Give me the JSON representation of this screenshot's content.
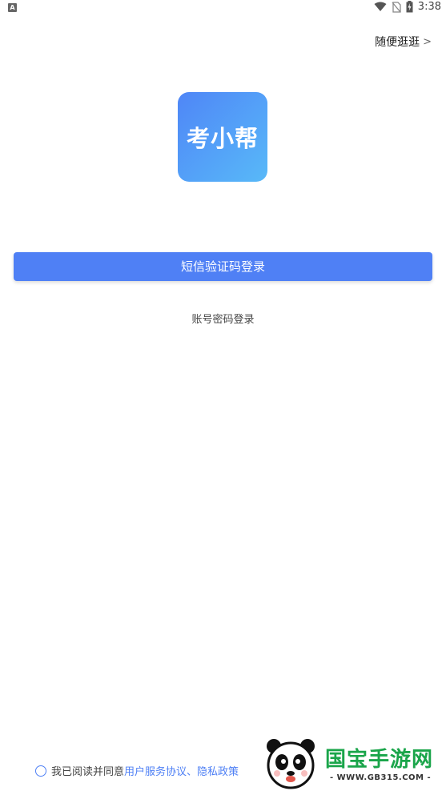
{
  "status_bar": {
    "notification_badge": "A",
    "time": "3:38",
    "icons": [
      "wifi-icon",
      "no-sim-icon",
      "battery-charging-icon"
    ]
  },
  "header": {
    "browse_label": "随便逛逛",
    "browse_chevron": ">"
  },
  "logo": {
    "text": "考小帮"
  },
  "login": {
    "sms_button_label": "短信验证码登录",
    "password_login_label": "账号密码登录"
  },
  "agreement": {
    "prefix": "我已阅读并同意",
    "user_agreement": "用户服务协议",
    "separator": "、",
    "privacy_policy": "隐私政策"
  },
  "watermark": {
    "title": "国宝手游网",
    "subtitle": "- WWW.GB315.COM -"
  },
  "colors": {
    "primary": "#4f80f5",
    "watermark_green": "#1aa54a"
  }
}
